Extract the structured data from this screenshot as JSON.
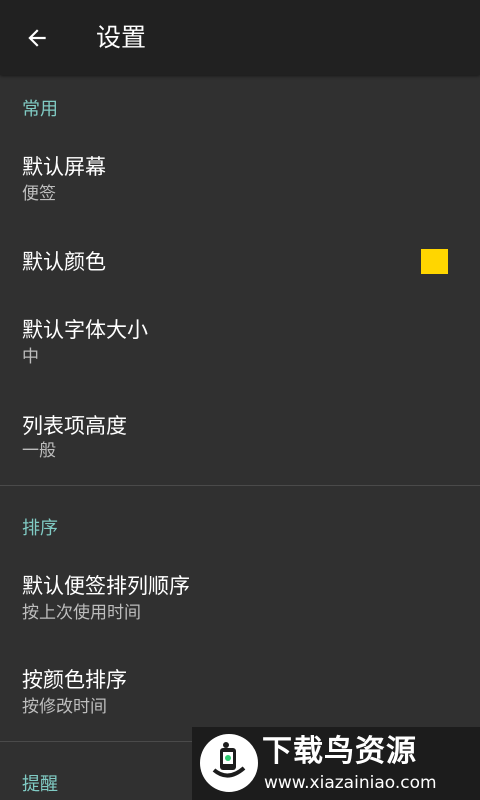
{
  "header": {
    "back_icon": "arrow-left-icon",
    "title": "设置"
  },
  "sections": {
    "general": {
      "header": "常用",
      "default_screen": {
        "title": "默认屏幕",
        "value": "便签"
      },
      "default_color": {
        "title": "默认颜色",
        "swatch_color": "#ffd600"
      },
      "default_font_size": {
        "title": "默认字体大小",
        "value": "中"
      },
      "list_item_height": {
        "title": "列表项高度",
        "value": "一般"
      }
    },
    "sort": {
      "header": "排序",
      "default_note_order": {
        "title": "默认便签排列顺序",
        "value": "按上次使用时间"
      },
      "sort_by_color": {
        "title": "按颜色排序",
        "value": "按修改时间"
      }
    },
    "reminder": {
      "header": "提醒"
    }
  },
  "colors": {
    "accent": "#80cbc4",
    "toolbar": "#212121",
    "background": "#303030"
  },
  "watermark": {
    "title": "下载鸟资源",
    "url": "www.xiazainiao.com"
  }
}
